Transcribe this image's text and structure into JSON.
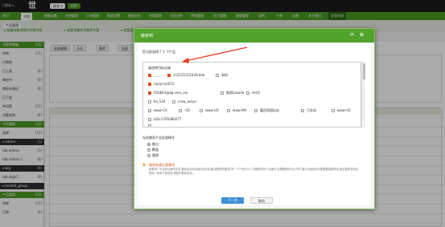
{
  "app": {
    "logo": "世",
    "logo_prefix": "已登录 ▾",
    "pills": [
      "易仓 ▾",
      "ERP"
    ]
  },
  "nav": {
    "items": [
      "首页",
      "刊登",
      "数据采集",
      "在线管理",
      "订单管理",
      "物流设置",
      "数据分析",
      "仓储管理",
      "业务分析",
      "营销管理",
      "员工管理",
      "客服管理",
      "案例",
      "工单",
      "设置",
      "关于我们",
      "应用市场"
    ]
  },
  "subnav": {
    "items": [
      "▸ 批量采集到我的刊登列表",
      "▸ 批量采集并采集到刊登",
      "▸ 批量复制产品"
    ]
  },
  "sidebar": {
    "items": [
      {
        "label": "刊登草稿箱",
        "count": "(11)",
        "style": "hd"
      },
      {
        "label": "  待审",
        "count": "(11)"
      },
      {
        "label": "  已审核",
        "count": ""
      },
      {
        "label": "    已上架",
        "count": "(0)"
      },
      {
        "label": "    审核中",
        "count": "(0)"
      },
      {
        "label": "    审核未通过",
        "count": "(0)"
      },
      {
        "label": "    已下架",
        "count": ""
      },
      {
        "label": "  待刊登",
        "count": "(11)"
      },
      {
        "label": "  刊登失败",
        "count": "(0)"
      },
      {
        "label": "平台数据",
        "count": "(11)",
        "style": "hd"
      },
      {
        "label": "  选择",
        "count": "(11)"
      },
      {
        "label": "▾ adress",
        "count": "(1)",
        "style": "dk"
      },
      {
        "label": "  tab adress",
        "count": "(1)"
      },
      {
        "label": "  tab adress 2",
        "count": "(0)"
      },
      {
        "label": "▾ wig",
        "count": "(0)",
        "style": "dk"
      },
      {
        "label": "  tab wigs1",
        "count": "(0)"
      },
      {
        "label": "▾ morbid_group",
        "count": "",
        "style": "dk"
      },
      {
        "label": "产品管理",
        "count": "(11)",
        "style": "hd"
      },
      {
        "label": "  待审",
        "count": "(11)"
      },
      {
        "label": "  已审",
        "count": "(0)"
      }
    ]
  },
  "main_bg": {
    "heading": "产品管理",
    "buttons": [
      "批量编辑",
      "分组",
      "删除",
      "批量",
      "更新",
      "导入"
    ]
  },
  "modal": {
    "title": "搬家到",
    "selected_text": "您当前选择了 1 个产品",
    "shop_title": "请选择目标店铺",
    "shops": [
      {
        "label": "_ _ _ .",
        "checked": true
      },
      {
        "label": "cn1515115435rdeb",
        "checked": true
      },
      {
        "label": "易码",
        "checked": false
      },
      {
        "label": "rapiynn2015",
        "checked": true
      },
      {
        "label": "650843@qq.com_my",
        "checked": true
      },
      {
        "label": "泰国Lazada",
        "checked": false
      },
      {
        "label": "test2",
        "checked": false
      },
      {
        "label": "ba_524",
        "checked": false
      },
      {
        "label": "crow_aukyn",
        "checked": false
      },
      {
        "label": "www-CA",
        "checked": false
      },
      {
        "label": "-US",
        "checked": false
      },
      {
        "label": "www-US",
        "checked": false
      },
      {
        "label": "www-MX",
        "checked": false
      },
      {
        "label": "墨西哥国际站",
        "checked": false
      },
      {
        "label": "日本站",
        "checked": false
      },
      {
        "label": "www-US",
        "checked": false
      },
      {
        "label": "b2b-1765086277",
        "checked": false
      },
      {
        "label": "_ _ _",
        "checked": false
      }
    ],
    "dest_label": "勾选搬家产品处理模式",
    "modes": [
      {
        "label": "跳过",
        "selected": true
      },
      {
        "label": "覆盖",
        "selected": false
      },
      {
        "label": "重建",
        "selected": false
      }
    ],
    "tip_title": "搬家前请注意事项",
    "tip_text": "如果某个平台的店铺不存在,搬家会自动创建对应的店铺,按照您的要求,同一个产品可以一次搬家到多个店铺中,如果搬家的平台不同,部分字段信息可能需要重新修改,建议搬家完成后再逐一检查产品信息,再做刊登和发布。",
    "ok_label": "下一步",
    "cancel_label": "取消"
  },
  "colors": {
    "accent": "#4c9a25",
    "arrow": "#e8391c"
  }
}
